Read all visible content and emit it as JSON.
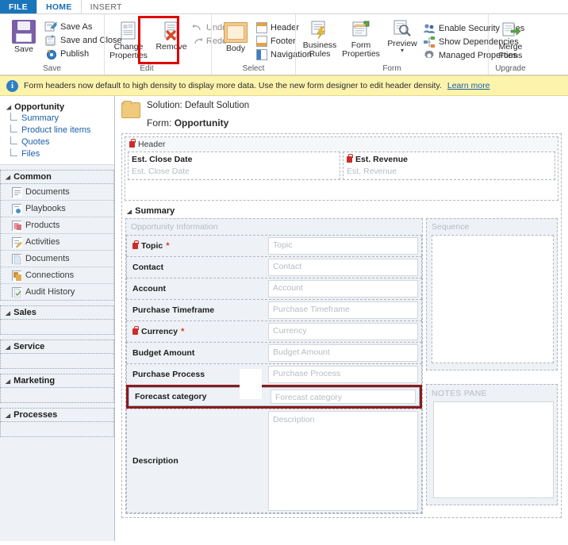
{
  "tabs": [
    {
      "label": "FILE",
      "state": "file"
    },
    {
      "label": "HOME",
      "state": "active"
    },
    {
      "label": "INSERT",
      "state": "normal"
    }
  ],
  "ribbon": {
    "groups": [
      {
        "title": "Save",
        "big": [
          {
            "label": "Save",
            "icon": "save-floppy-icon"
          }
        ],
        "small": [
          {
            "label": "Save As",
            "icon": "save-as-icon"
          },
          {
            "label": "Save and Close",
            "icon": "save-and-close-icon"
          },
          {
            "label": "Publish",
            "icon": "publish-icon"
          }
        ]
      },
      {
        "title": "Edit",
        "big": [
          {
            "label": "Change Properties",
            "icon": "change-properties-icon"
          },
          {
            "label": "Remove",
            "icon": "remove-icon",
            "highlighted": true
          }
        ],
        "small": [
          {
            "label": "Undo",
            "icon": "undo-icon",
            "disabled": true
          },
          {
            "label": "Redo",
            "icon": "redo-icon",
            "disabled": true
          }
        ]
      },
      {
        "title": "Select",
        "big": [
          {
            "label": "Body",
            "icon": "body-icon"
          }
        ],
        "small": [
          {
            "label": "Header",
            "icon": "header-icon"
          },
          {
            "label": "Footer",
            "icon": "footer-icon"
          },
          {
            "label": "Navigation",
            "icon": "navigation-icon"
          }
        ]
      },
      {
        "title": "Form",
        "big": [
          {
            "label": "Business Rules",
            "icon": "business-rules-icon"
          },
          {
            "label": "Form Properties",
            "icon": "form-properties-icon"
          },
          {
            "label": "Preview",
            "icon": "preview-icon",
            "dropdown": true
          }
        ],
        "small": [
          {
            "label": "Enable Security Roles",
            "icon": "security-roles-icon"
          },
          {
            "label": "Show Dependencies",
            "icon": "dependencies-icon"
          },
          {
            "label": "Managed Properties",
            "icon": "managed-properties-icon"
          }
        ]
      },
      {
        "title": "Upgrade",
        "big": [
          {
            "label": "Merge Forms",
            "icon": "merge-forms-icon"
          }
        ],
        "small": []
      }
    ]
  },
  "notification": {
    "icon": "info-icon",
    "text": "Form headers now default to high density to display more data. Use the new form designer to edit header density.",
    "link": "Learn more"
  },
  "sidebar": {
    "root": "Opportunity",
    "children": [
      "Summary",
      "Product line items",
      "Quotes",
      "Files"
    ],
    "groups": [
      {
        "title": "Common",
        "items": [
          {
            "label": "Documents",
            "icon": "documents-icon"
          },
          {
            "label": "Playbooks",
            "icon": "playbooks-icon"
          },
          {
            "label": "Products",
            "icon": "products-icon"
          },
          {
            "label": "Activities",
            "icon": "activities-icon"
          },
          {
            "label": "Documents",
            "icon": "documents-icon"
          },
          {
            "label": "Connections",
            "icon": "connections-icon"
          },
          {
            "label": "Audit History",
            "icon": "audit-history-icon"
          }
        ]
      },
      {
        "title": "Sales",
        "items": []
      },
      {
        "title": "Service",
        "items": []
      },
      {
        "title": "Marketing",
        "items": []
      },
      {
        "title": "Processes",
        "items": []
      }
    ]
  },
  "canvas": {
    "solution_label": "Solution: Default Solution",
    "form_prefix": "Form:",
    "form_name": "Opportunity",
    "header_section": {
      "label": "Header",
      "locked": true,
      "fields": [
        {
          "label": "Est. Close Date",
          "placeholder": "Est. Close Date",
          "locked": false
        },
        {
          "label": "Est. Revenue",
          "placeholder": "Est. Revenue",
          "locked": true
        }
      ]
    },
    "summary_tab": "Summary",
    "left_panel": {
      "title": "Opportunity Information",
      "fields": [
        {
          "label": "Topic",
          "placeholder": "Topic",
          "locked": true,
          "required": true
        },
        {
          "label": "Contact",
          "placeholder": "Contact",
          "locked": false,
          "required": false
        },
        {
          "label": "Account",
          "placeholder": "Account",
          "locked": false,
          "required": false
        },
        {
          "label": "Purchase Timeframe",
          "placeholder": "Purchase Timeframe",
          "locked": false,
          "required": false
        },
        {
          "label": "Currency",
          "placeholder": "Currency",
          "locked": true,
          "required": true
        },
        {
          "label": "Budget Amount",
          "placeholder": "Budget Amount",
          "locked": false,
          "required": false
        },
        {
          "label": "Purchase Process",
          "placeholder": "Purchase Process",
          "locked": false,
          "required": false
        }
      ],
      "highlighted_field": {
        "label": "Forecast category",
        "placeholder": "Forecast category"
      },
      "description_field": {
        "label": "Description",
        "placeholder": "Description"
      }
    },
    "right_panel": {
      "sequence_title": "Sequence",
      "notes_title": "NOTES PANE"
    }
  },
  "colors": {
    "file_tab": "#1a75bb",
    "active_tab_text": "#1a6fb5",
    "notification_bg": "#fcf3ad",
    "highlight_red": "#e00000",
    "field_highlight_red": "#8f1a1a",
    "required_star": "#d43f2a",
    "lock_red": "#cc2b2b"
  }
}
